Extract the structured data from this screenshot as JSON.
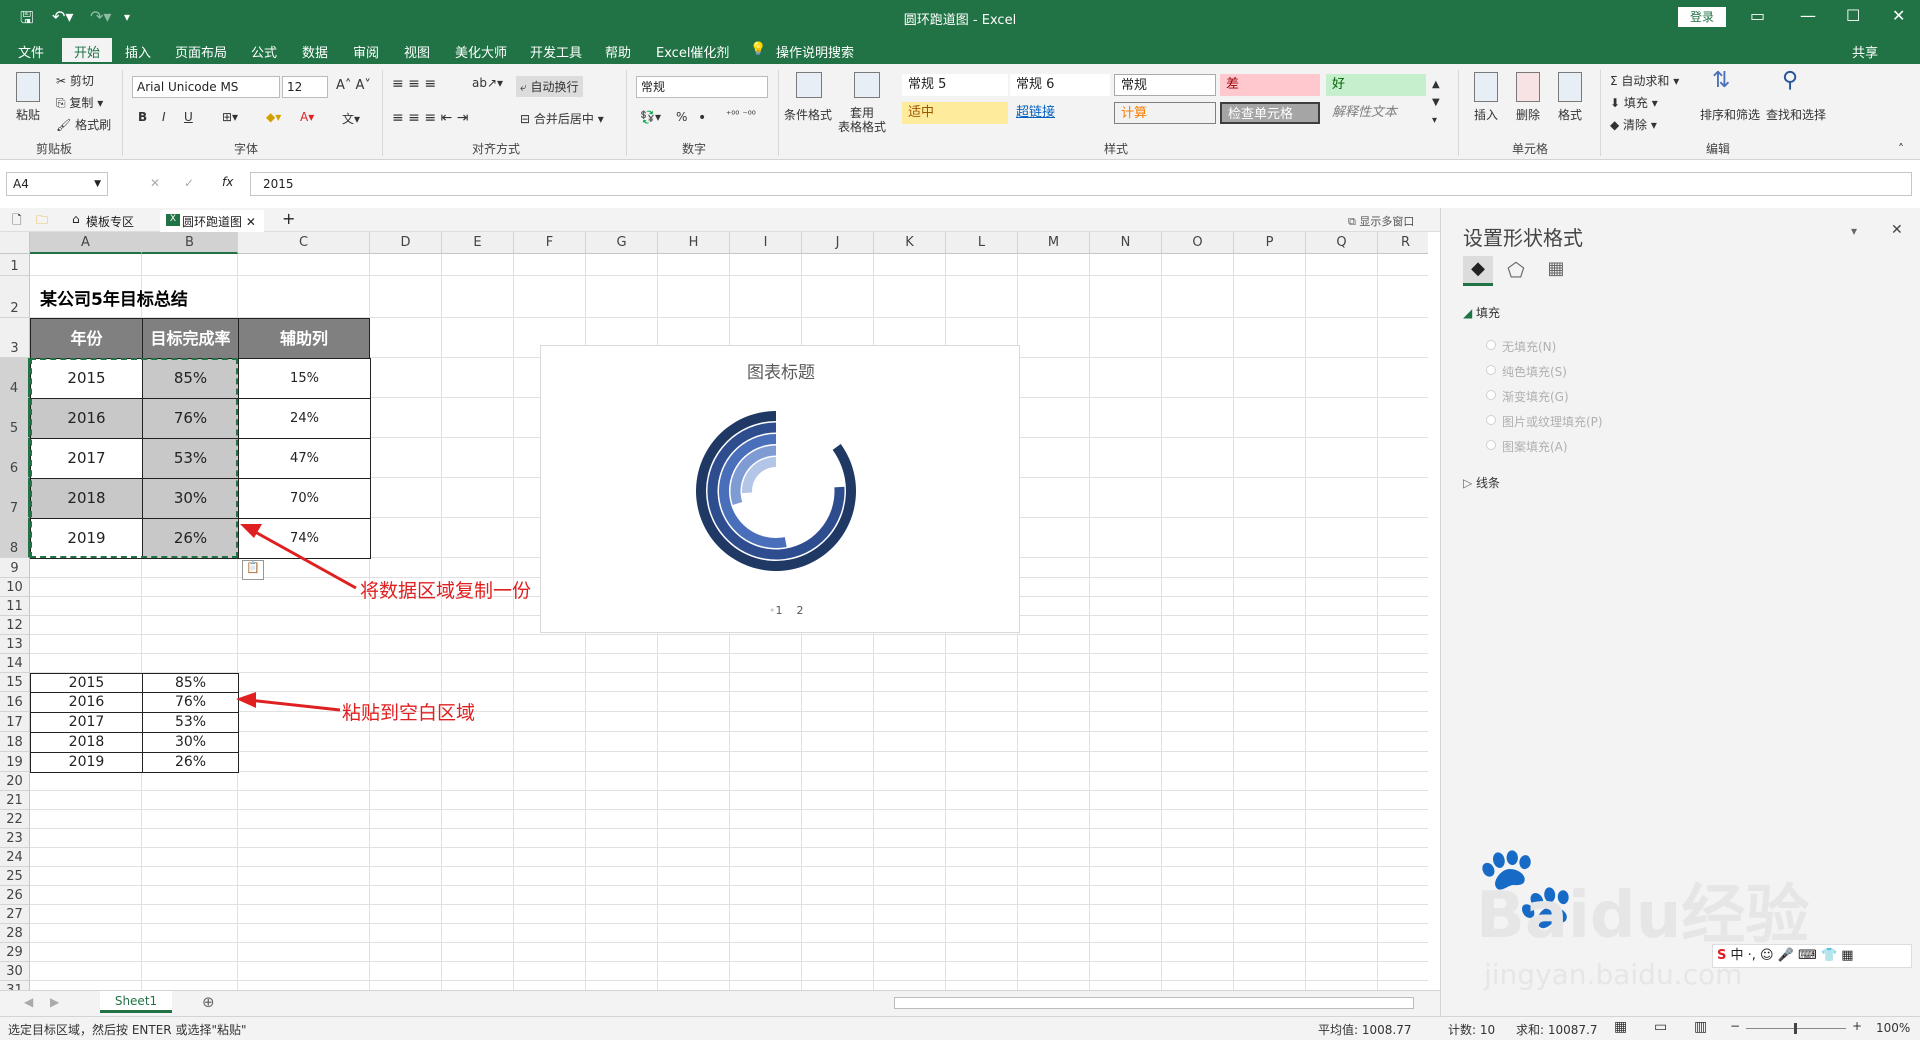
{
  "titlebar": {
    "title": "圆环跑道图 - Excel",
    "login": "登录"
  },
  "menu": [
    "文件",
    "开始",
    "插入",
    "页面布局",
    "公式",
    "数据",
    "审阅",
    "视图",
    "美化大师",
    "开发工具",
    "帮助",
    "Excel催化剂",
    "操作说明搜索",
    "共享"
  ],
  "ribbon": {
    "clipboard": {
      "paste": "粘贴",
      "cut": "剪切",
      "copy": "复制",
      "format_painter": "格式刷",
      "label": "剪贴板"
    },
    "font": {
      "name": "Arial Unicode MS",
      "size": "12",
      "bold": "B",
      "italic": "I",
      "underline": "U",
      "label": "字体"
    },
    "align": {
      "wrap": "自动换行",
      "merge": "合并后居中",
      "label": "对齐方式"
    },
    "number": {
      "format": "常规",
      "percent": "%",
      "comma": "•",
      "label": "数字"
    },
    "styles": {
      "cond_format": "条件格式",
      "table_format": "套用\n表格格式",
      "cells": [
        "常规 5",
        "常规 6",
        "常规",
        "差",
        "好",
        "适中",
        "超链接",
        "计算",
        "检查单元格",
        "解释性文本"
      ],
      "label": "样式"
    },
    "cells_grp": {
      "insert": "插入",
      "delete": "删除",
      "format": "格式",
      "label": "单元格"
    },
    "editing": {
      "autosum": "自动求和",
      "fill": "填充",
      "clear": "清除",
      "sort": "排序和筛选",
      "find": "查找和选择",
      "label": "编辑"
    }
  },
  "formula_bar": {
    "namebox": "A4",
    "fx": "fx",
    "value": "2015"
  },
  "workbook_tabs": {
    "templates": "模板专区",
    "file": "圆环跑道图",
    "show_windows": "显示多窗口"
  },
  "columns": [
    "A",
    "B",
    "C",
    "D",
    "E",
    "F",
    "G",
    "H",
    "I",
    "J",
    "K",
    "L",
    "M",
    "N",
    "O",
    "P",
    "Q",
    "R"
  ],
  "rows": [
    "1",
    "2",
    "3",
    "4",
    "5",
    "6",
    "7",
    "8",
    "9",
    "10",
    "11",
    "12",
    "13",
    "14",
    "15",
    "16",
    "17",
    "18",
    "19",
    "20",
    "21",
    "22",
    "23",
    "24",
    "25",
    "26",
    "27",
    "28",
    "29",
    "30",
    "31"
  ],
  "table": {
    "title": "某公司5年目标总结",
    "headers": [
      "年份",
      "目标完成率",
      "辅助列"
    ],
    "rows": [
      [
        "2015",
        "85%",
        "15%"
      ],
      [
        "2016",
        "76%",
        "24%"
      ],
      [
        "2017",
        "53%",
        "47%"
      ],
      [
        "2018",
        "30%",
        "70%"
      ],
      [
        "2019",
        "26%",
        "74%"
      ]
    ]
  },
  "pasted": [
    [
      "2015",
      "85%"
    ],
    [
      "2016",
      "76%"
    ],
    [
      "2017",
      "53%"
    ],
    [
      "2018",
      "30%"
    ],
    [
      "2019",
      "26%"
    ]
  ],
  "annotations": {
    "copy": "将数据区域复制一份",
    "paste": "粘贴到空白区域"
  },
  "chart": {
    "title": "图表标题",
    "legend": [
      "1",
      "2"
    ],
    "colors": [
      "#1f3864",
      "#2e4d8f",
      "#4a6fba",
      "#7f9bd4",
      "#b4c6e7"
    ]
  },
  "chart_data": {
    "type": "pie",
    "title": "图表标题",
    "categories": [
      "2015",
      "2016",
      "2017",
      "2018",
      "2019"
    ],
    "series": [
      {
        "name": "1",
        "values": [
          85,
          76,
          53,
          30,
          26
        ]
      },
      {
        "name": "2",
        "values": [
          15,
          24,
          47,
          70,
          74
        ]
      }
    ]
  },
  "pane": {
    "title": "设置形状格式",
    "fill_section": "填充",
    "options": [
      "无填充(N)",
      "纯色填充(S)",
      "渐变填充(G)",
      "图片或纹理填充(P)",
      "图案填充(A)"
    ],
    "line_section": "线条"
  },
  "sheet_tab": "Sheet1",
  "status": {
    "message": "选定目标区域，然后按 ENTER 或选择\"粘贴\"",
    "average": "平均值: 1008.77",
    "count": "计数: 10",
    "sum": "求和: 10087.7",
    "zoom": "100%"
  },
  "watermark": {
    "brand": "Baidu经验",
    "url": "jingyan.baidu.com"
  },
  "ime": {
    "label": "中"
  }
}
